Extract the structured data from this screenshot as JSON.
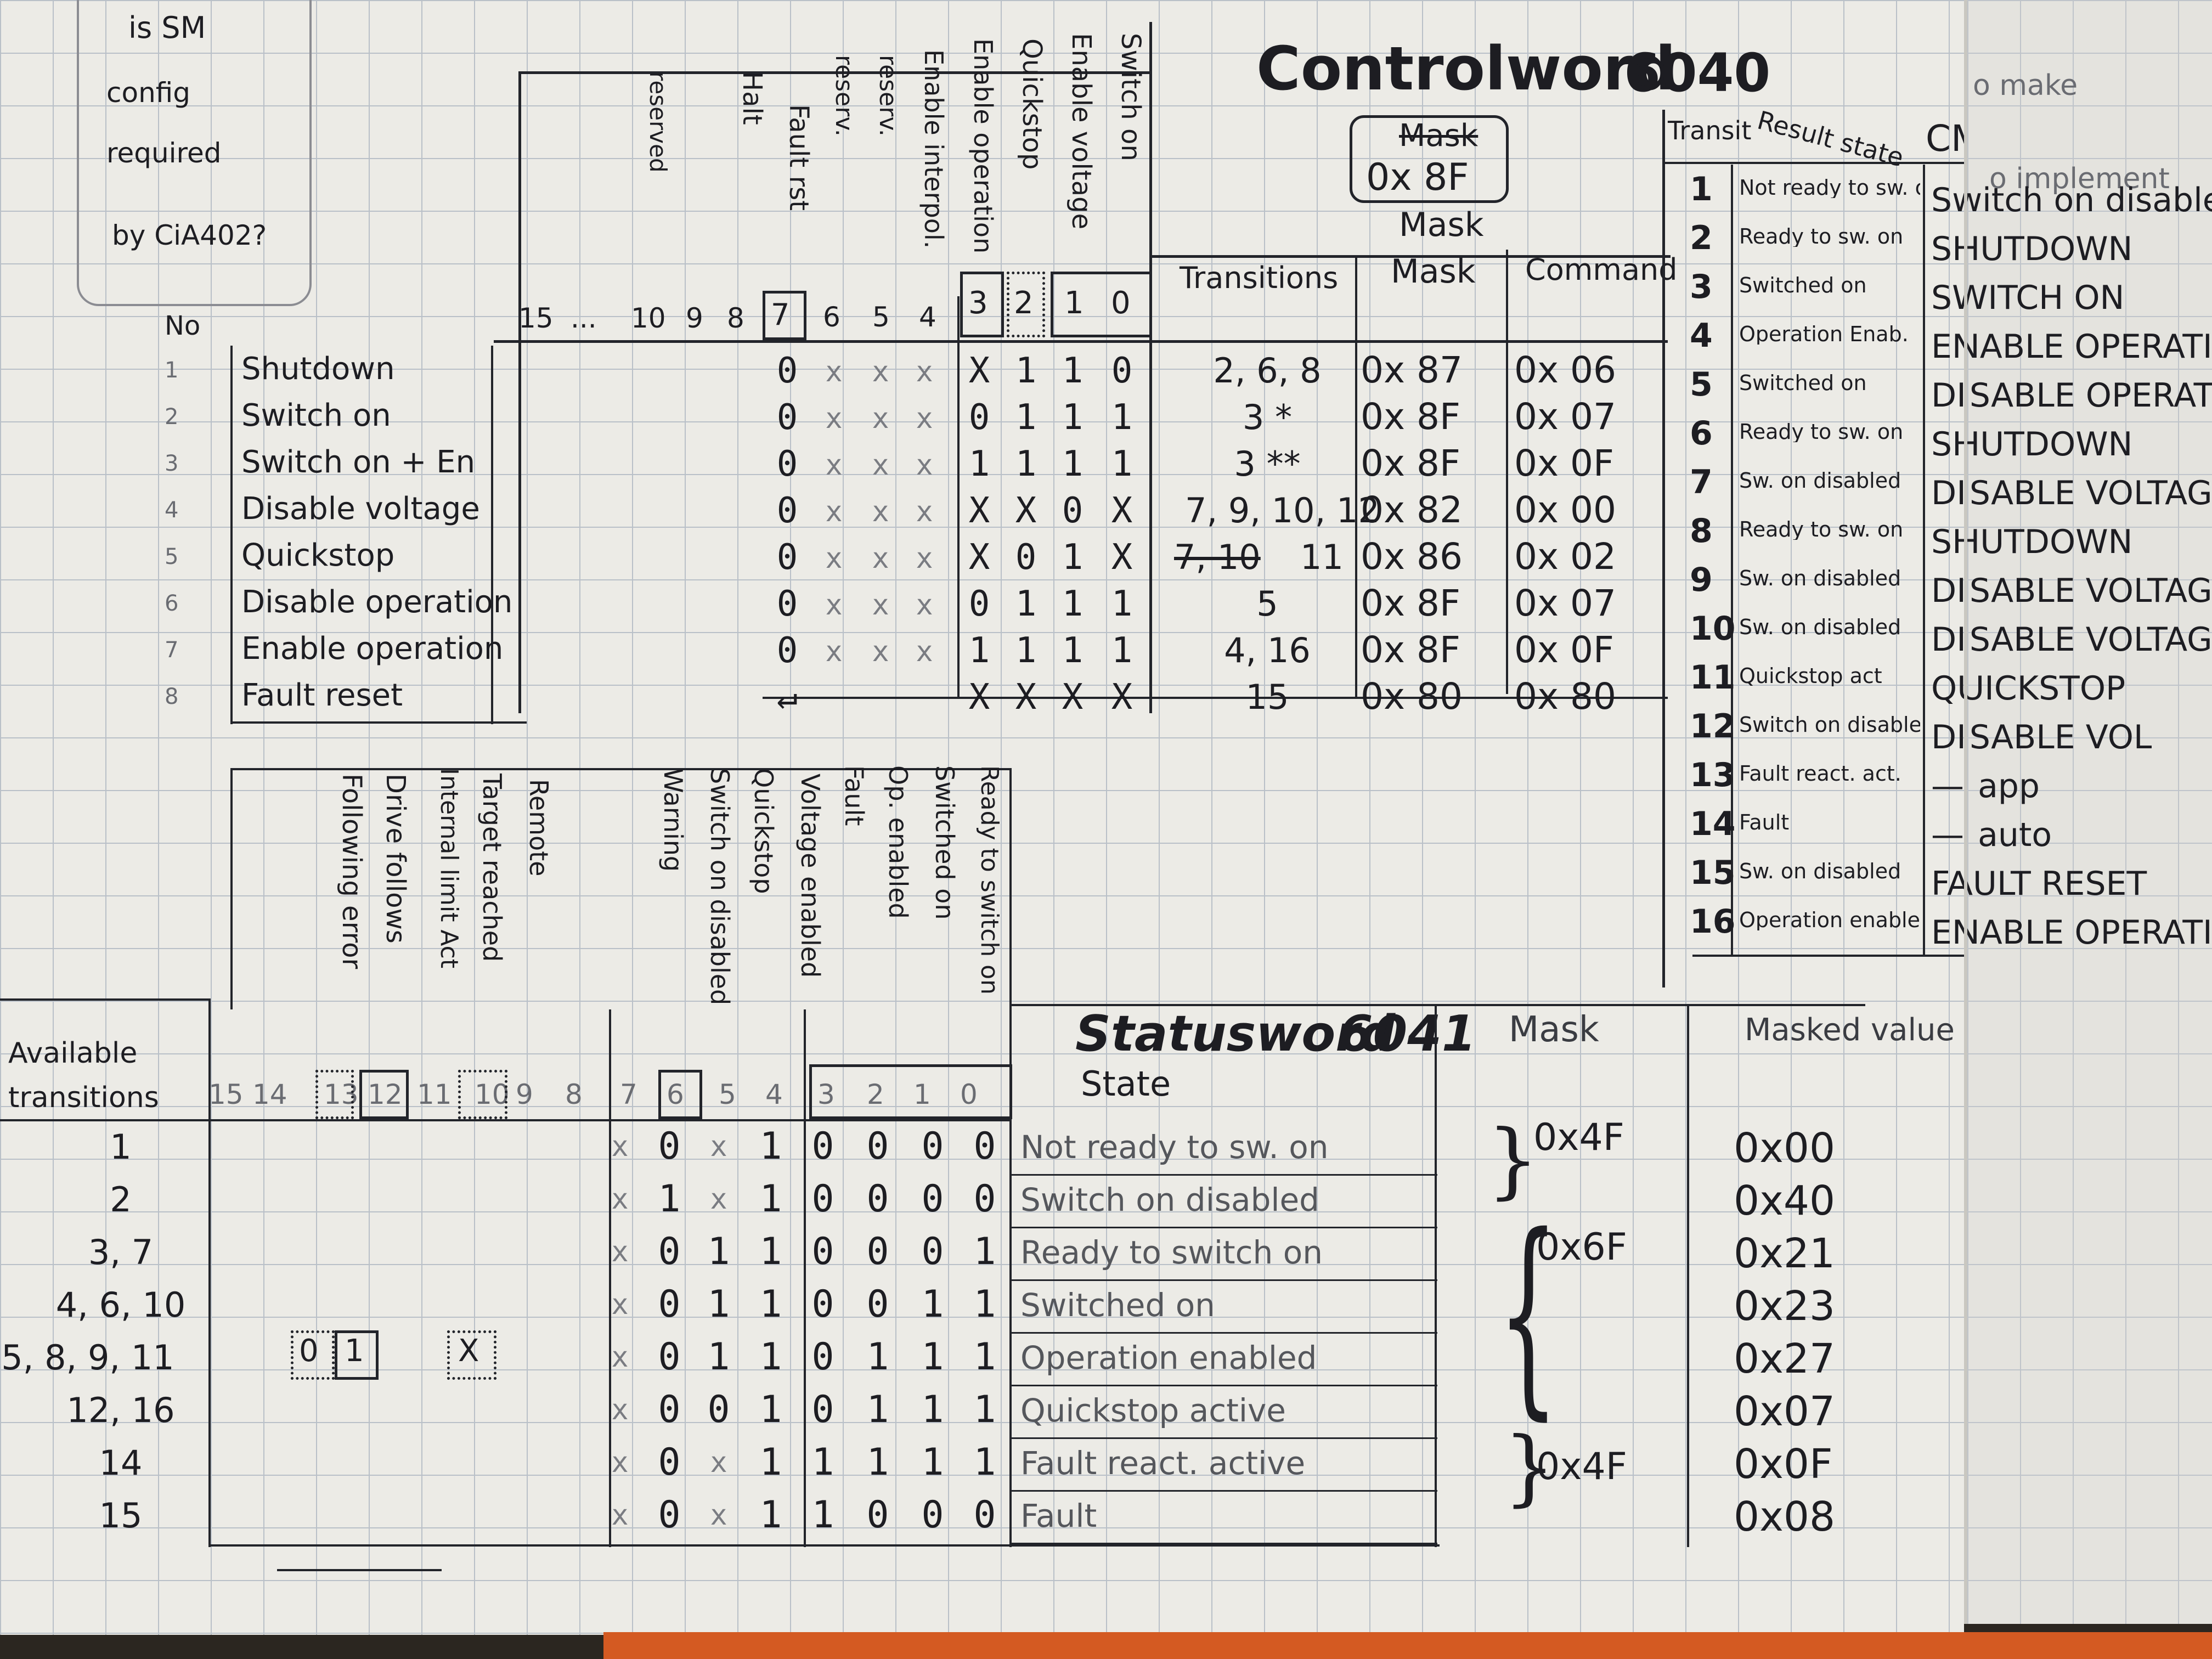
{
  "note": {
    "lines": [
      "is SM",
      "config",
      "required",
      "by CiA402?"
    ]
  },
  "controlword": {
    "title": "Controlword",
    "index": "6040",
    "mask_note": {
      "struck": "Mask",
      "value": "0x 8F"
    },
    "bit_names": [
      "Switch on",
      "Enable voltage",
      "Quickstop",
      "Enable operation",
      "Enable interpol.",
      "reserv.",
      "reserv.",
      "Fault rst",
      "Halt",
      "reserved"
    ],
    "bit_header": [
      "15",
      "...",
      "10",
      "9",
      "8",
      "7",
      "6",
      "5",
      "4",
      "3",
      "2",
      "1",
      "0"
    ],
    "no_label": "No",
    "columns": {
      "transitions": "Transitions",
      "mask_top": "Mask",
      "mask": "Mask",
      "command": "Command"
    },
    "rows": [
      {
        "no": "1",
        "name": "Shutdown",
        "bits": [
          "0",
          "x",
          "x",
          "x",
          "X",
          "1",
          "1",
          "0"
        ],
        "transitions": "2, 6, 8",
        "mask": "0x 87",
        "command": "0x 06"
      },
      {
        "no": "2",
        "name": "Switch on",
        "bits": [
          "0",
          "x",
          "x",
          "x",
          "0",
          "1",
          "1",
          "1"
        ],
        "transitions": "3 *",
        "mask": "0x 8F",
        "command": "0x 07"
      },
      {
        "no": "3",
        "name": "Switch on + En",
        "bits": [
          "0",
          "x",
          "x",
          "x",
          "1",
          "1",
          "1",
          "1"
        ],
        "transitions": "3 **",
        "mask": "0x 8F",
        "command": "0x 0F"
      },
      {
        "no": "4",
        "name": "Disable voltage",
        "bits": [
          "0",
          "x",
          "x",
          "x",
          "X",
          "X",
          "0",
          "X"
        ],
        "transitions": "7, 9, 10, 12",
        "mask": "0x 82",
        "command": "0x 00"
      },
      {
        "no": "5",
        "name": "Quickstop",
        "bits": [
          "0",
          "x",
          "x",
          "x",
          "X",
          "0",
          "1",
          "X"
        ],
        "transitions": "11",
        "transitions_struck": "7, 10",
        "mask": "0x 86",
        "command": "0x 02"
      },
      {
        "no": "6",
        "name": "Disable operation",
        "bits": [
          "0",
          "x",
          "x",
          "x",
          "0",
          "1",
          "1",
          "1"
        ],
        "transitions": "5",
        "mask": "0x 8F",
        "command": "0x 07"
      },
      {
        "no": "7",
        "name": "Enable operation",
        "bits": [
          "0",
          "x",
          "x",
          "x",
          "1",
          "1",
          "1",
          "1"
        ],
        "transitions": "4, 16",
        "mask": "0x 8F",
        "command": "0x 0F"
      },
      {
        "no": "8",
        "name": "Fault reset",
        "bits": [
          "↵",
          "",
          "",
          "",
          "X",
          "X",
          "X",
          "X"
        ],
        "transitions": "15",
        "mask": "0x 80",
        "command": "0x 80"
      }
    ]
  },
  "transition_table": {
    "headers": [
      "Transit",
      "Result state",
      "CMD"
    ],
    "rows": [
      {
        "n": "1",
        "state": "Not ready to sw. on",
        "cmd": "Switch on disabled"
      },
      {
        "n": "2",
        "state": "Ready to sw. on",
        "cmd": "SHUTDOWN"
      },
      {
        "n": "3",
        "state": "Switched on",
        "cmd": "SWITCH ON"
      },
      {
        "n": "4",
        "state": "Operation Enab.",
        "cmd": "ENABLE OPERATION"
      },
      {
        "n": "5",
        "state": "Switched on",
        "cmd": "DISABLE OPERATION"
      },
      {
        "n": "6",
        "state": "Ready to sw. on",
        "cmd": "SHUTDOWN"
      },
      {
        "n": "7",
        "state": "Sw. on disabled",
        "cmd": "DISABLE VOLTAGE"
      },
      {
        "n": "8",
        "state": "Ready to sw. on",
        "cmd": "SHUTDOWN"
      },
      {
        "n": "9",
        "state": "Sw. on disabled",
        "cmd": "DISABLE VOLTAGE"
      },
      {
        "n": "10",
        "state": "Sw. on disabled",
        "cmd": "DISABLE VOLTAGE"
      },
      {
        "n": "11",
        "state": "Quickstop act",
        "cmd": "QUICKSTOP"
      },
      {
        "n": "12",
        "state": "Switch on disabled",
        "cmd": "DISABLE VOL"
      },
      {
        "n": "13",
        "state": "Fault react. act.",
        "cmd": "— app"
      },
      {
        "n": "14",
        "state": "Fault",
        "cmd": "— auto"
      },
      {
        "n": "15",
        "state": "Sw. on disabled",
        "cmd": "FAULT RESET"
      },
      {
        "n": "16",
        "state": "Operation enabled",
        "cmd": "ENABLE OPERATION"
      }
    ]
  },
  "right_notes": [
    "o make",
    "o implement"
  ],
  "statusword": {
    "title": "Statusword",
    "index": "6041",
    "state_label": "State",
    "mask_label": "Mask",
    "masked_label": "Masked value",
    "avail_label": "Available transitions",
    "bit_names": [
      "Ready to switch on",
      "Switched on",
      "Op. enabled",
      "Fault",
      "Voltage enabled",
      "Quickstop",
      "Switch on disabled",
      "Warning",
      "",
      "Remote",
      "Target reached",
      "Internal limit Act",
      "Drive follows",
      "Following error"
    ],
    "bit_header": [
      "15",
      "14",
      "13",
      "12",
      "11",
      "10",
      "9",
      "8",
      "7",
      "6",
      "5",
      "4",
      "3",
      "2",
      "1",
      "0"
    ],
    "rows": [
      {
        "avail": "1",
        "bits": [
          "x",
          "0",
          "x",
          "1",
          "0",
          "0",
          "0",
          "0"
        ],
        "state": "Not ready to sw. on",
        "masked": "0x00"
      },
      {
        "avail": "2",
        "bits": [
          "x",
          "1",
          "x",
          "1",
          "0",
          "0",
          "0",
          "0"
        ],
        "state": "Switch on disabled",
        "masked": "0x40"
      },
      {
        "avail": "3, 7",
        "bits": [
          "x",
          "0",
          "1",
          "1",
          "0",
          "0",
          "0",
          "1"
        ],
        "state": "Ready to switch on",
        "masked": "0x21"
      },
      {
        "avail": "4, 6, 10",
        "bits": [
          "x",
          "0",
          "1",
          "1",
          "0",
          "0",
          "1",
          "1"
        ],
        "state": "Switched on",
        "masked": "0x23"
      },
      {
        "avail": "5, 8, 9, 11",
        "bits": [
          "x",
          "0",
          "1",
          "1",
          "0",
          "1",
          "1",
          "1"
        ],
        "state": "Operation enabled",
        "masked": "0x27"
      },
      {
        "avail": "12, 16",
        "bits": [
          "x",
          "0",
          "0",
          "1",
          "0",
          "1",
          "1",
          "1"
        ],
        "state": "Quickstop active",
        "masked": "0x07"
      },
      {
        "avail": "14",
        "bits": [
          "x",
          "0",
          "x",
          "1",
          "1",
          "1",
          "1",
          "1"
        ],
        "state": "Fault react. active",
        "masked": "0x0F"
      },
      {
        "avail": "15",
        "bits": [
          "x",
          "0",
          "x",
          "1",
          "1",
          "0",
          "0",
          "0"
        ],
        "state": "Fault",
        "masked": "0x08"
      }
    ],
    "masks": [
      "0x4F",
      "0x6F",
      "0x4F"
    ],
    "special_bits": [
      "0",
      "1",
      "X"
    ]
  }
}
